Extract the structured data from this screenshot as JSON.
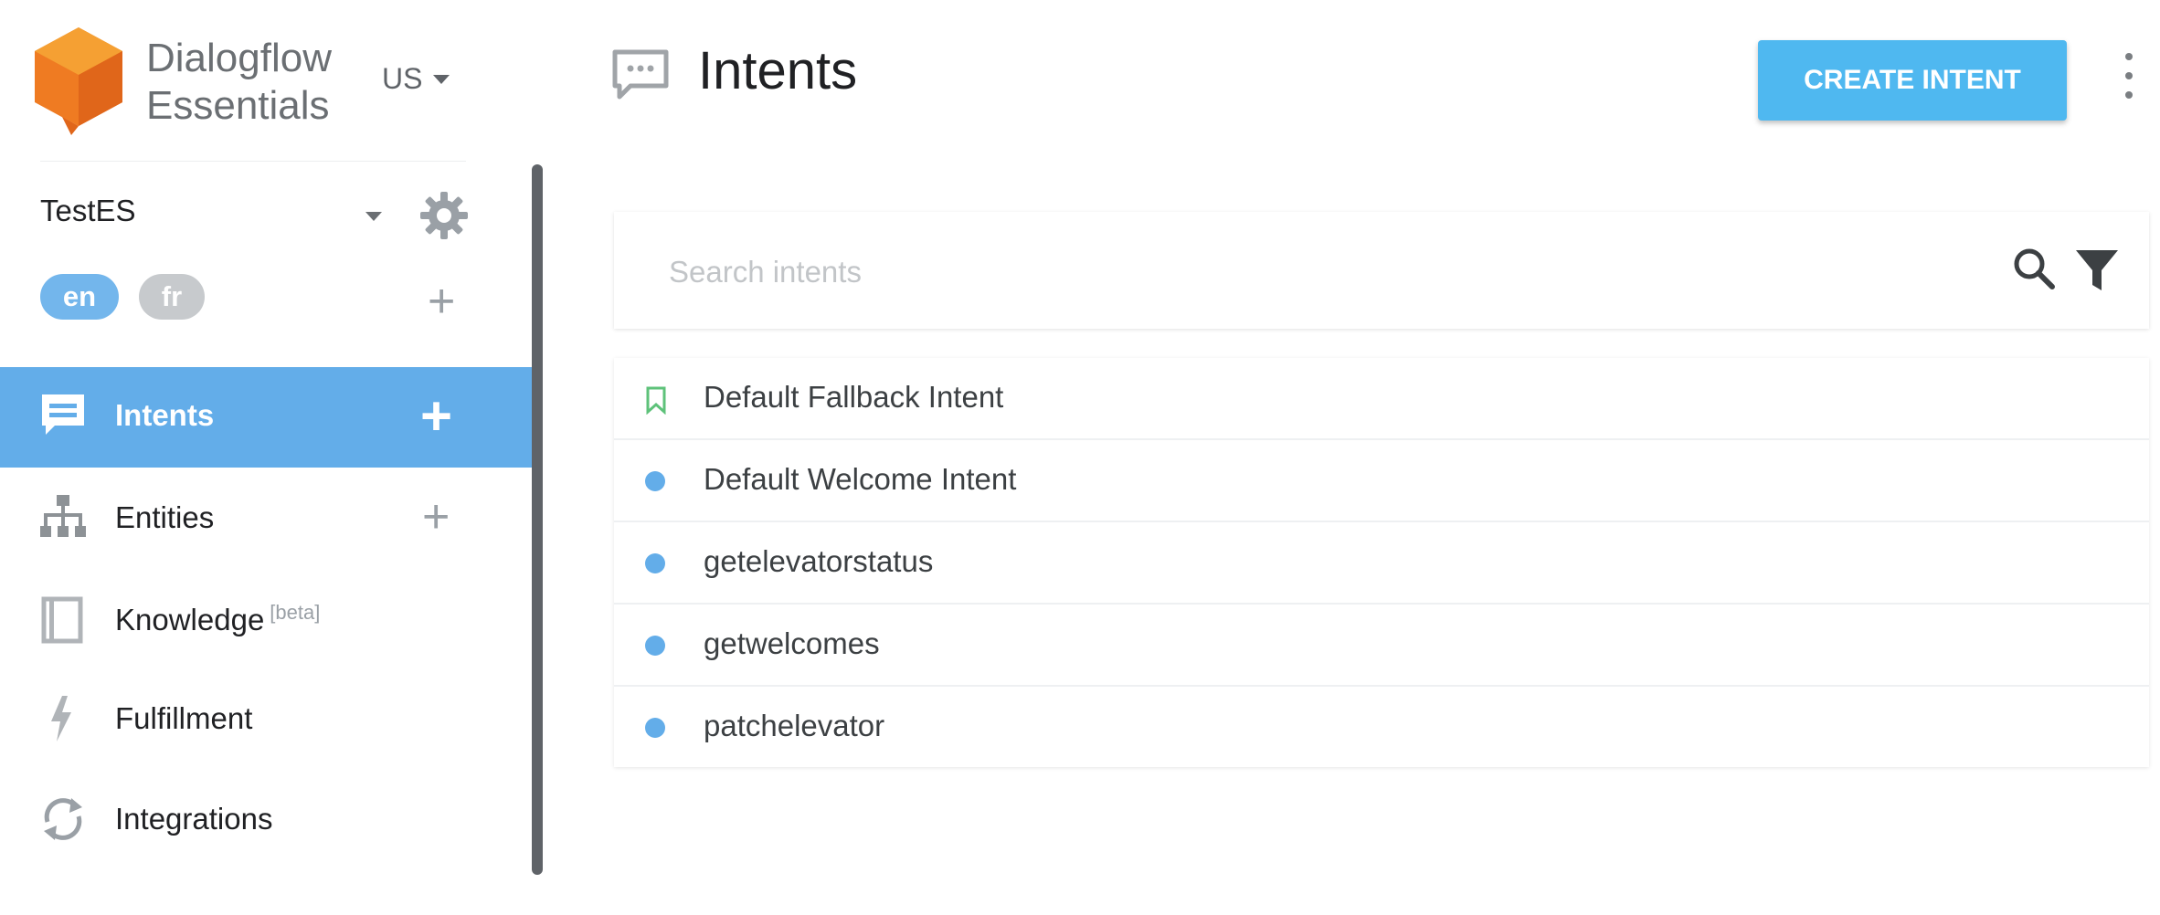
{
  "brand": {
    "line1": "Dialogflow",
    "line2": "Essentials"
  },
  "region": {
    "label": "US"
  },
  "agent": {
    "name": "TestES"
  },
  "languages": [
    {
      "code": "en",
      "selected": true
    },
    {
      "code": "fr",
      "selected": false
    }
  ],
  "sidebar": {
    "items": [
      {
        "label": "Intents",
        "icon": "chat-icon",
        "active": true,
        "has_add": true
      },
      {
        "label": "Entities",
        "icon": "hierarchy-icon",
        "active": false,
        "has_add": true
      },
      {
        "label": "Knowledge",
        "badge": "[beta]",
        "icon": "book-icon",
        "active": false,
        "has_add": false
      },
      {
        "label": "Fulfillment",
        "icon": "bolt-icon",
        "active": false,
        "has_add": false
      },
      {
        "label": "Integrations",
        "icon": "sync-icon",
        "active": false,
        "has_add": false
      }
    ]
  },
  "header": {
    "title": "Intents",
    "create_button": "CREATE INTENT"
  },
  "search": {
    "placeholder": "Search intents"
  },
  "intents": [
    {
      "name": "Default Fallback Intent",
      "marker": "fallback-flag-icon"
    },
    {
      "name": "Default Welcome Intent",
      "marker": "dot"
    },
    {
      "name": "getelevatorstatus",
      "marker": "dot"
    },
    {
      "name": "getwelcomes",
      "marker": "dot"
    },
    {
      "name": "patchelevator",
      "marker": "dot"
    }
  ],
  "colors": {
    "accent": "#63ade9",
    "button": "#4fb8f0",
    "logo_orange": "#ef7b22",
    "fallback_green": "#5ec27a"
  }
}
